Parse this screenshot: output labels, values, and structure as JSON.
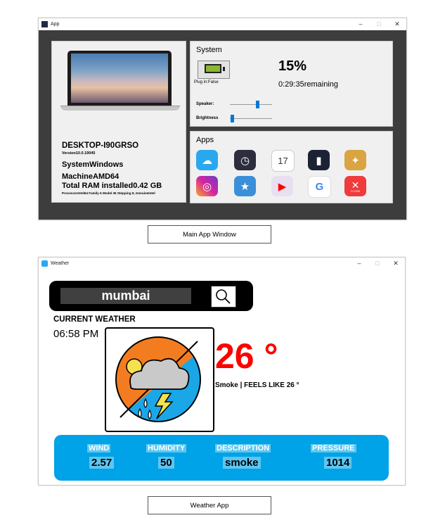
{
  "main_window": {
    "title": "App",
    "pc": {
      "name": "DESKTOP-I90GRSO",
      "version": "Version10.0.19045",
      "system": "SystemWindows",
      "machine": "MachineAMD64",
      "ram": "Total RAM installed0.42 GB",
      "processor": "ProcessorIntel64 Family 6 Model 35 Stepping 8, GenuineIntel"
    },
    "system": {
      "title": "System",
      "battery_percent": "15%",
      "battery_level": 0.15,
      "plug_status": "Plug in:False",
      "time_remaining": "0:29:35remaining",
      "speaker_label": "Speaker:",
      "speaker_level": 0.65,
      "brightness_label": "Brightness",
      "brightness_level": 0.05
    },
    "apps": {
      "title": "Apps",
      "items": [
        {
          "name": "weather-app-icon",
          "color": "#1e90ff"
        },
        {
          "name": "clock-app-icon",
          "color": "#2d2d3d"
        },
        {
          "name": "calendar-app-icon",
          "color": "#ffffff",
          "label": "17"
        },
        {
          "name": "toggle-app-icon",
          "color": "#1a2233"
        },
        {
          "name": "game-app-icon",
          "color": "#d9a441"
        },
        {
          "name": "instagram-app-icon",
          "color": "#d6249f"
        },
        {
          "name": "files-app-icon",
          "color": "#3b8fd9"
        },
        {
          "name": "youtube-app-icon",
          "color": "#ff0000"
        },
        {
          "name": "google-app-icon",
          "color": "#4285f4",
          "label": "G"
        },
        {
          "name": "close-app-icon",
          "color": "#ef3b3b",
          "label": "CLOSE"
        }
      ]
    },
    "caption": "Main App Window"
  },
  "weather_window": {
    "title": "Weather",
    "search": {
      "value": "mumbai"
    },
    "current_weather_label": "CURRENT WEATHER",
    "time": "06:58 PM",
    "temperature": "26 °",
    "description_line": "Smoke | FEELS LIKE 26 °",
    "stats": {
      "wind_label": "WIND",
      "wind_value": "2.57",
      "humidity_label": "HUMIDITY",
      "humidity_value": "50",
      "description_label": "DESCRIPTION",
      "description_value": "smoke",
      "pressure_label": "PRESSURE",
      "pressure_value": "1014"
    },
    "caption": "Weather App"
  },
  "window_controls": {
    "minimize": "–",
    "maximize": "□",
    "close": "✕"
  },
  "colors": {
    "accent": "#00a2e8",
    "temperature": "#ff0000",
    "slider": "#0078d7"
  }
}
